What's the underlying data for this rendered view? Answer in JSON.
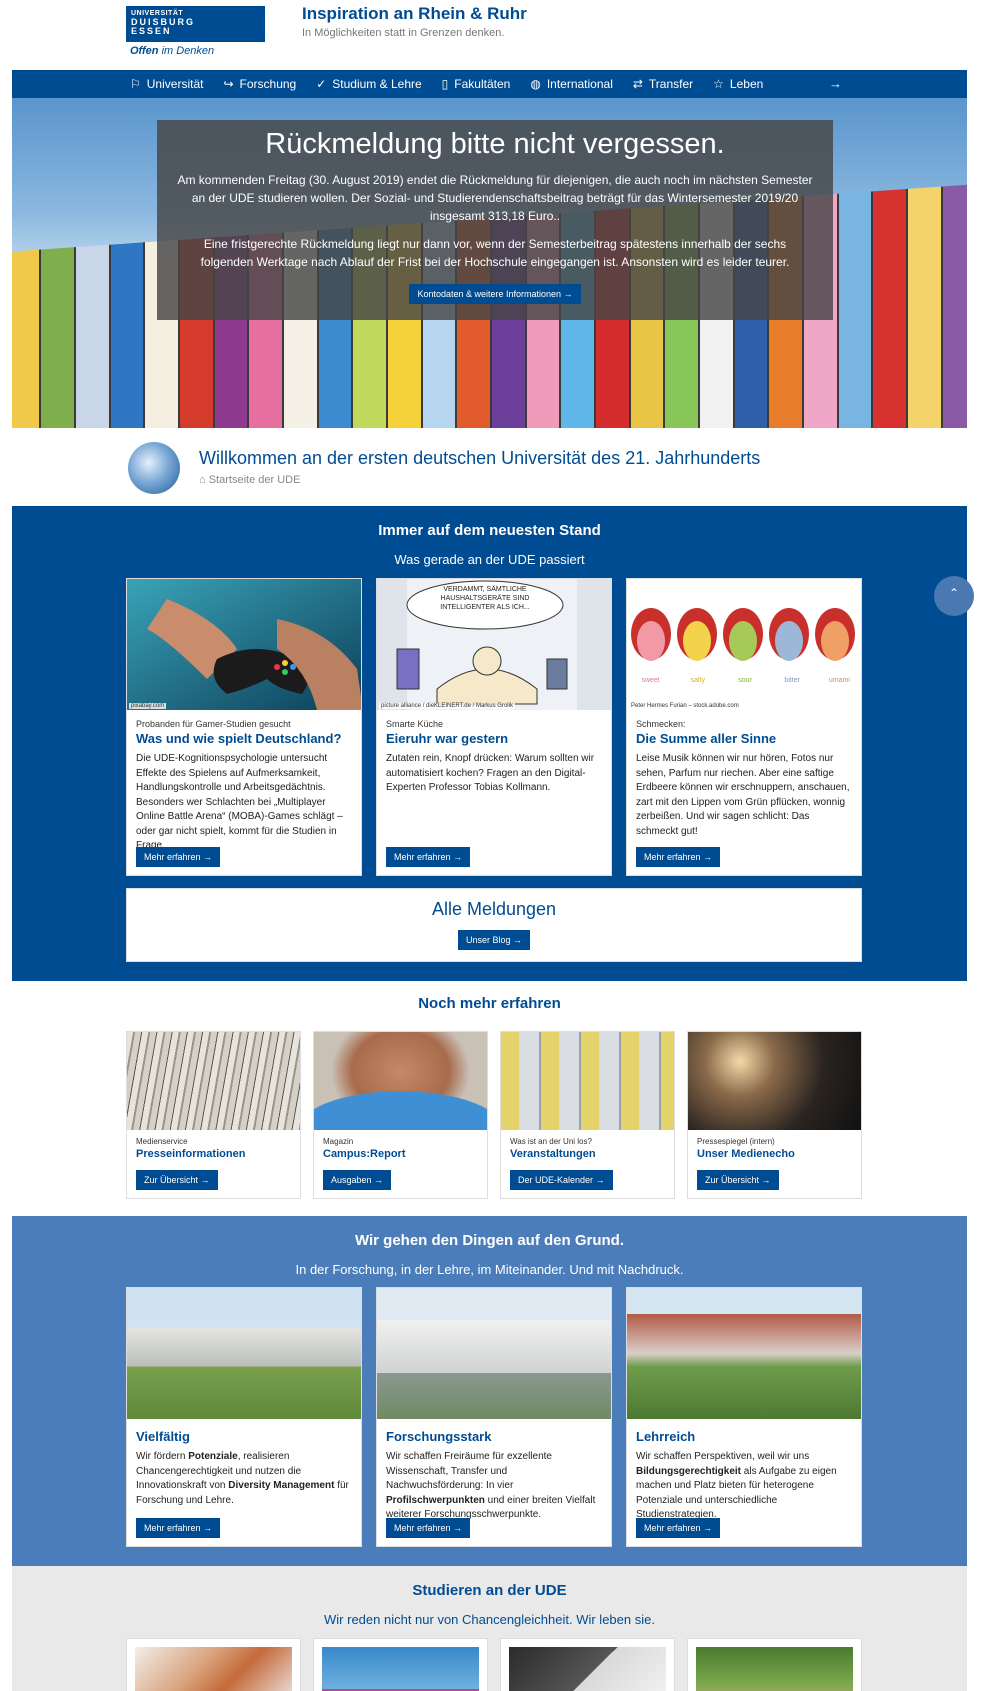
{
  "header": {
    "logo_line1": "UNIVERSITÄT",
    "logo_line2": "DUISBURG",
    "logo_line3": "ESSEN",
    "logo_slogan_a": "Offen",
    "logo_slogan_b": " im Denken",
    "title": "Inspiration an Rhein & Ruhr",
    "subtitle": "In Möglichkeiten statt in Grenzen denken."
  },
  "nav": {
    "items": [
      {
        "label": "Universität",
        "icon": "flag-icon",
        "glyph": "⚐"
      },
      {
        "label": "Forschung",
        "icon": "share-icon",
        "glyph": "↪"
      },
      {
        "label": "Studium & Lehre",
        "icon": "check-icon",
        "glyph": "✓"
      },
      {
        "label": "Fakultäten",
        "icon": "bookmark-icon",
        "glyph": "▯"
      },
      {
        "label": "International",
        "icon": "globe-icon",
        "glyph": "◍"
      },
      {
        "label": "Transfer",
        "icon": "transfer-icon",
        "glyph": "⇄"
      },
      {
        "label": "Leben",
        "icon": "star-icon",
        "glyph": "☆"
      }
    ],
    "more_glyph": "→"
  },
  "hero": {
    "title": "Rückmeldung bitte nicht vergessen.",
    "paragraph1": "Am kommenden Freitag (30. August 2019) endet die Rückmeldung für diejenigen, die auch noch im nächsten Semester an der UDE studieren wollen. Der Sozial- und Studierendenschaftsbeitrag beträgt für das Wintersemester 2019/20 insgesamt 313,18 Euro..",
    "paragraph2": "Eine fristgerechte Rückmeldung liegt nur dann vor, wenn der Semesterbeitrag spätestens innerhalb der sechs folgenden Werktage nach Ablauf der Frist bei der Hochschule eingegangen ist. Ansonsten wird es leider teurer.",
    "button": "Kontodaten & weitere Informationen  →",
    "stripe_colors": [
      "#e7a23a",
      "#f0c84a",
      "#7fae4d",
      "#c9d6e8",
      "#2f77c2",
      "#f4efe1",
      "#d43b2a",
      "#8e3a8f",
      "#e76fa0",
      "#f5f0e6",
      "#3c8bd0",
      "#c0d95c",
      "#f6d23a",
      "#b6d6f0",
      "#e25b2d",
      "#6b3f9a",
      "#ef9bb9",
      "#5fb6e8",
      "#d42c2c",
      "#e9c545",
      "#89c65a",
      "#f1f1f1",
      "#2f5fa8",
      "#e77c2a",
      "#f0a6c6",
      "#79b5e2",
      "#d7322f",
      "#f4d36b",
      "#8a5aa7",
      "#f1f1ea"
    ]
  },
  "welcome": {
    "title": "Willkommen an der ersten deutschen Universität des 21. Jahrhunderts",
    "breadcrumb": "Startseite der UDE",
    "home_glyph": "⌂"
  },
  "news": {
    "title": "Immer auf dem neuesten Stand",
    "subtitle": "Was gerade an der UDE passiert",
    "cards": [
      {
        "credit": "pixabay.com",
        "kicker": "Probanden für Gamer-Studien gesucht",
        "title": "Was und wie spielt Deutschland?",
        "text": "Die UDE-Kognitionspsychologie untersucht Effekte des Spielens auf Aufmerksamkeit, Handlungskontrolle und Arbeitsgedächtnis. Besonders wer Schlachten bei „Multiplayer Online Battle Arena“ (MOBA)-Games schlägt – oder gar nicht spielt, kommt für die Studien in Frage.",
        "button": "Mehr erfahren  →"
      },
      {
        "credit": "picture alliance / dieKLEINERT.de / Markus Grolik",
        "kicker": "Smarte Küche",
        "title": "Eieruhr war gestern",
        "text": "Zutaten rein, Knopf drücken: Warum sollten wir automatisiert kochen? Fragen an den Digital-Experten Professor Tobias Kollmann.",
        "button": "Mehr erfahren  →",
        "cartoon_text": "VERDAMMT, SÄMTLICHE HAUSHALTSGERÄTE SIND INTELLIGENTER ALS ICH..."
      },
      {
        "credit": "Peter Hermes Furian – stock.adobe.com",
        "kicker": "Schmecken:",
        "title": "Die Summe aller Sinne",
        "text": "Leise Musik können wir nur hören, Fotos nur sehen, Parfum nur riechen. Aber eine saftige Erdbeere können wir erschnuppern, anschauen, zart mit den Lippen vom Grün pflücken, wonnig zerbeißen. Und wir sagen schlicht: Das schmeckt gut!",
        "button": "Mehr erfahren  →",
        "tastes": [
          "sweet",
          "salty",
          "sour",
          "bitter",
          "umami"
        ]
      }
    ],
    "all_title": "Alle Meldungen",
    "all_button": "Unser Blog  →",
    "scroll_glyph": "⌃"
  },
  "more": {
    "title": "Noch mehr erfahren",
    "cards": [
      {
        "kicker": "Medienservice",
        "title": "Presseinformationen",
        "button": "Zur Übersicht  →"
      },
      {
        "kicker": "Magazin",
        "title": "Campus:Report",
        "button": "Ausgaben  →"
      },
      {
        "kicker": "Was ist an der Uni los?",
        "title": "Veranstaltungen",
        "button": "Der UDE-Kalender  →"
      },
      {
        "kicker": "Pressespiegel (intern)",
        "title": "Unser Medienecho",
        "button": "Zur Übersicht  →"
      }
    ]
  },
  "research": {
    "title": "Wir gehen den Dingen auf den Grund.",
    "subtitle": "In der Forschung, in der Lehre, im Miteinander. Und mit Nachdruck.",
    "cards": [
      {
        "title": "Vielfältig",
        "t1": "Wir fördern ",
        "b1": "Potenziale",
        "t2": ", realisieren Chancengerechtigkeit und nutzen die Innovationskraft von ",
        "b2": "Diversity Management",
        "t3": " für Forschung und Lehre.",
        "button": "Mehr erfahren  →"
      },
      {
        "title": "Forschungsstark",
        "t1": "Wir schaffen Freiräume für exzellente Wissenschaft, Transfer und Nachwuchsförderung: In vier ",
        "b1": "Profilschwerpunkten",
        "t2": " und einer breiten Vielfalt weiterer Forschungsschwerpunkte.",
        "b2": "",
        "t3": "",
        "button": "Mehr erfahren  →"
      },
      {
        "title": "Lehrreich",
        "t1": "Wir schaffen Perspektiven, weil wir uns ",
        "b1": "Bildungsgerechtigkeit",
        "t2": " als Aufgabe zu eigen machen und Platz bieten für heterogene Potenziale und unterschiedliche Studienstrategien.",
        "b2": "",
        "t3": "",
        "button": "Mehr erfahren  →"
      }
    ]
  },
  "study": {
    "title": "Studieren an der UDE",
    "subtitle": "Wir reden nicht nur von Chancengleichheit. Wir leben sie."
  },
  "colors": {
    "brand_blue": "#004c93",
    "research_blue": "#4a7dba",
    "study_grey": "#e9e9e9"
  }
}
